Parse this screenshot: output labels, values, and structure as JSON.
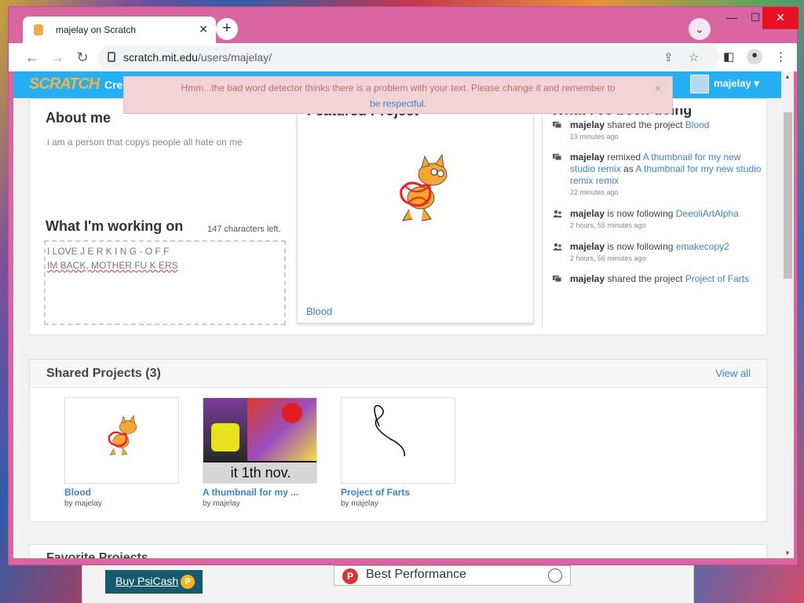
{
  "browser": {
    "tab_title": "majelay on Scratch",
    "url_host": "scratch.mit.edu",
    "url_path": "/users/majelay/",
    "new_tab": "+",
    "close_tab": "✕"
  },
  "nav": {
    "logo": "SCRATCH",
    "create": "Cre",
    "username": "majelay ▾"
  },
  "alert": {
    "message": "Hmm...the bad word detector thinks there is a problem with your text. Please change it and remember to",
    "link": "be respectful.",
    "close": "×"
  },
  "profile": {
    "about_title": "About me",
    "about_text": "i am a person that copys people all hate on me",
    "working_title": "What I'm working on",
    "chars_left": "147 characters left.",
    "working_line1": "I LOVE J E R K I N G - O F F",
    "working_line2": "IM BACK, MOTHER FU K ERS",
    "featured_title": "Featured Project",
    "featured_project": "Blood",
    "activity_title": "What I've been doing",
    "activity": [
      {
        "user": "majelay",
        "text1": " shared the project ",
        "link1": "Blood",
        "text2": "",
        "link2": "",
        "time": "19 minutes ago",
        "icon": "project-icon"
      },
      {
        "user": "majelay",
        "text1": " remixed ",
        "link1": "A thumbnail for my new studio remix",
        "text2": " as ",
        "link2": "A thumbnail for my new studio remix remix",
        "time": "22 minutes ago",
        "icon": "project-icon"
      },
      {
        "user": "majelay",
        "text1": " is now following ",
        "link1": "DeeoliArtAlpha",
        "text2": "",
        "link2": "",
        "time": "2 hours, 55 minutes ago",
        "icon": "follow-icon"
      },
      {
        "user": "majelay",
        "text1": " is now following ",
        "link1": "emakecopy2",
        "text2": "",
        "link2": "",
        "time": "2 hours, 56 minutes ago",
        "icon": "follow-icon"
      },
      {
        "user": "majelay",
        "text1": " shared the project ",
        "link1": "Project of Farts",
        "text2": "",
        "link2": "",
        "time": "",
        "icon": "project-icon"
      }
    ]
  },
  "shared": {
    "title": "Shared Projects (3)",
    "view_all": "View all",
    "projects": [
      {
        "title": "Blood",
        "by": "by majelay"
      },
      {
        "title": "A thumbnail for my ...",
        "by": "by majelay",
        "caption": "it 1th nov."
      },
      {
        "title": "Project of Farts",
        "by": "by majelay"
      }
    ]
  },
  "favorites": {
    "title": "Favorite Projects"
  },
  "background": {
    "psicash": "Buy PsiCash",
    "best_performance": "Best Performance"
  },
  "colors": {
    "scratch_nav": "#25aff4",
    "link": "#3a84c9",
    "window_frame": "#d966a0",
    "alert_bg": "#f3d4d6"
  }
}
